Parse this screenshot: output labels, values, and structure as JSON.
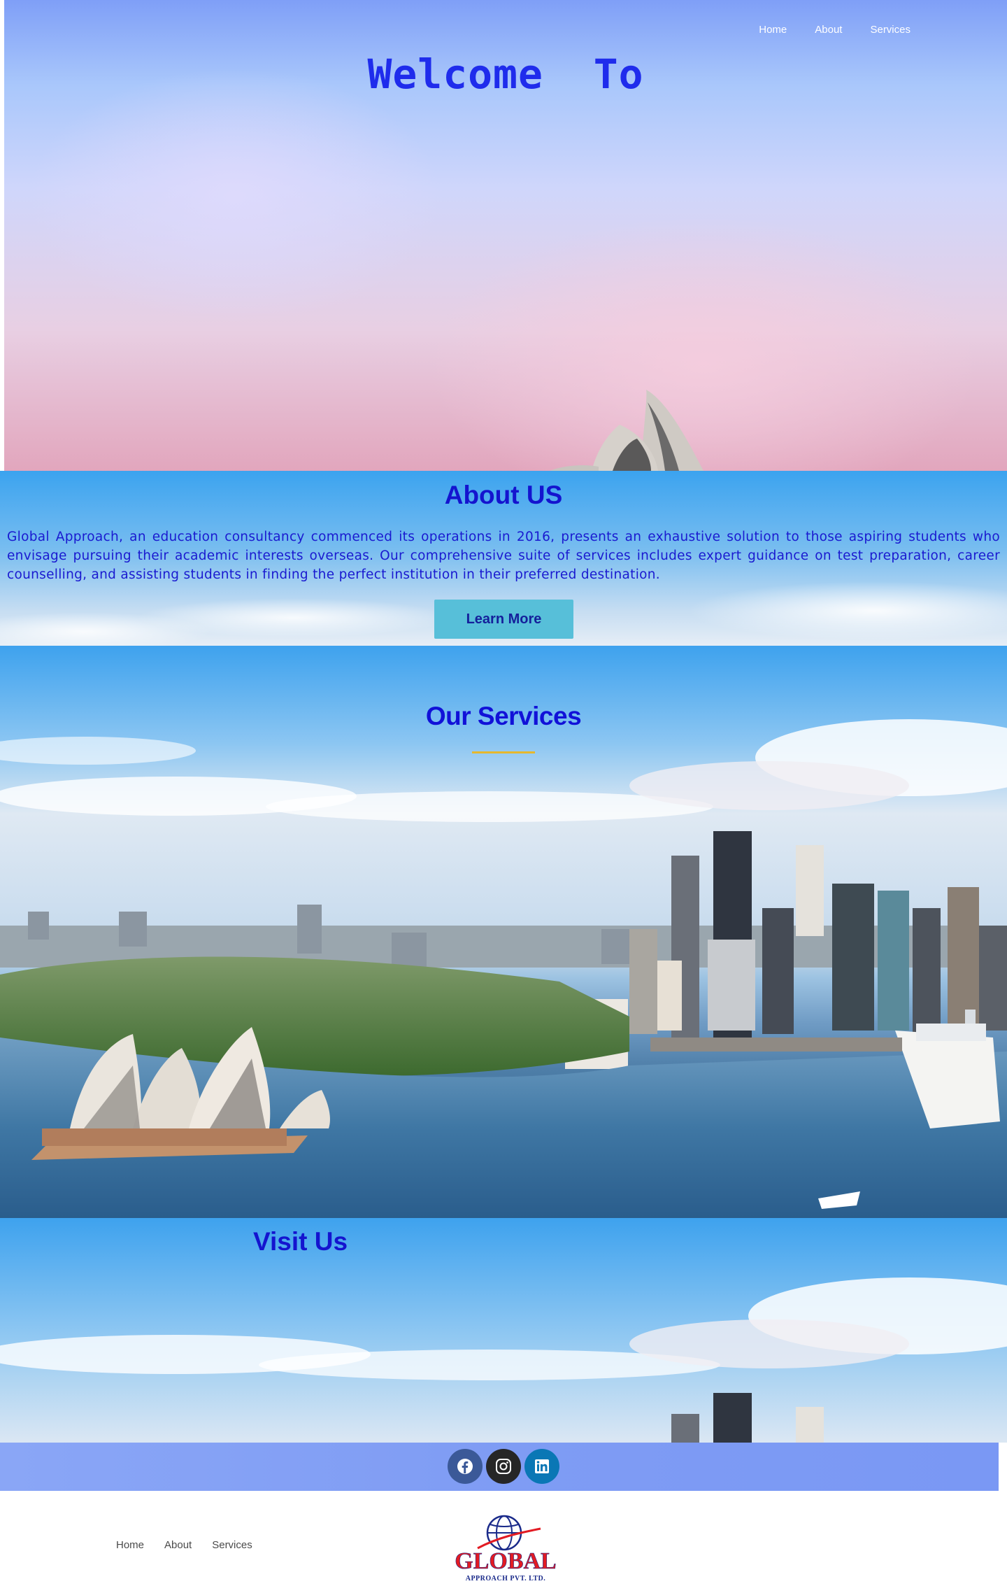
{
  "hero": {
    "nav": [
      "Home",
      "About",
      "Services"
    ],
    "title": "Welcome  To"
  },
  "about": {
    "title": "About US",
    "text": "Global Approach, an education consultancy commenced its operations in 2016, presents an exhaustive solution to those aspiring students who envisage pursuing their academic interests overseas. Our comprehensive suite of services includes expert guidance on test preparation, career counselling, and assisting students in finding the perfect institution in their preferred destination.",
    "button": "Learn More"
  },
  "services": {
    "title": "Our Services",
    "accent_color": "#e6b82e"
  },
  "visit": {
    "title": "Visit Us"
  },
  "social": {
    "icons": [
      "facebook-icon",
      "instagram-icon",
      "linkedin-icon"
    ]
  },
  "footer": {
    "nav": [
      "Home",
      "About",
      "Services"
    ],
    "logo_main": "GLOBAL",
    "logo_sub": "APPROACH PVT. LTD."
  },
  "colors": {
    "heading": "#1414cf",
    "button_bg": "#57bfd9",
    "logo_red": "#e21b23",
    "logo_blue": "#1a2a8a"
  }
}
